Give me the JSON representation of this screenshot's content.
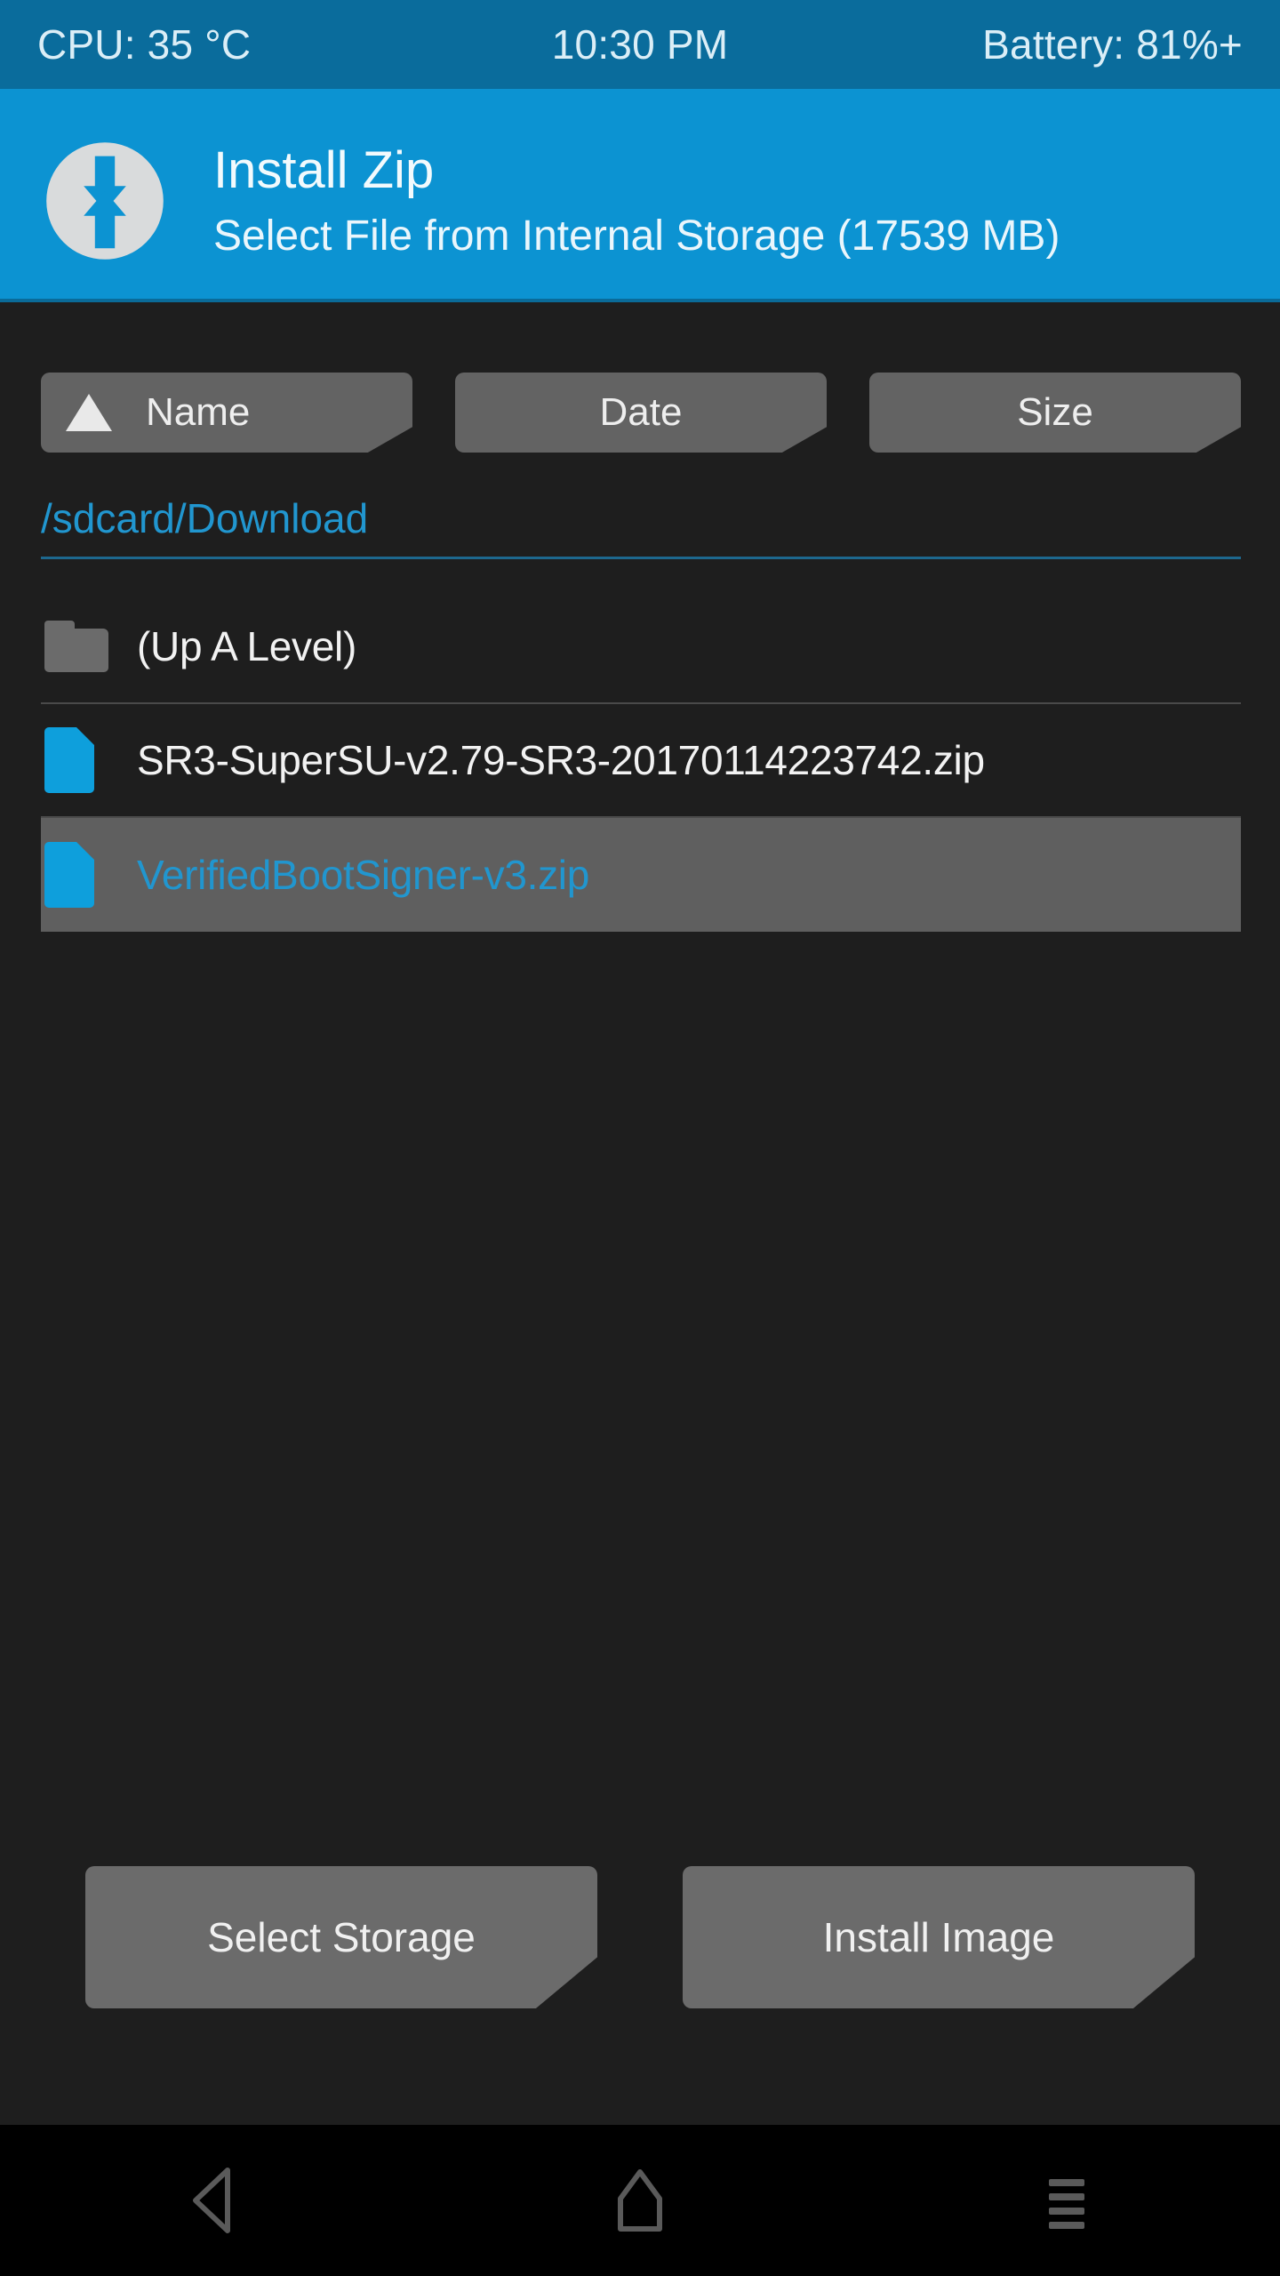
{
  "statusbar": {
    "cpu": "CPU: 35 °C",
    "time": "10:30 PM",
    "battery": "Battery: 81%+"
  },
  "header": {
    "logo_icon": "twrp-logo-icon",
    "title": "Install Zip",
    "subtitle": "Select File from Internal Storage (17539 MB)"
  },
  "sort": {
    "buttons": [
      {
        "label": "Name",
        "icon": "sort-ascending-triangle-icon",
        "active": true
      },
      {
        "label": "Date",
        "icon": "",
        "active": false
      },
      {
        "label": "Size",
        "icon": "",
        "active": false
      }
    ]
  },
  "path": {
    "current": "/sdcard/Download"
  },
  "files": [
    {
      "name": "(Up A Level)",
      "icon": "folder-icon",
      "type": "folder",
      "selected": false
    },
    {
      "name": "SR3-SuperSU-v2.79-SR3-20170114223742.zip",
      "icon": "file-icon",
      "type": "file",
      "selected": false
    },
    {
      "name": "VerifiedBootSigner-v3.zip",
      "icon": "file-icon",
      "type": "file",
      "selected": true
    }
  ],
  "actions": {
    "select_storage": "Select Storage",
    "install_image": "Install Image"
  },
  "navbar": {
    "back_icon": "back-triangle-icon",
    "home_icon": "home-icon",
    "menu_icon": "menu-lines-icon"
  },
  "colors": {
    "statusbar_bg": "#0a6c9c",
    "header_bg": "#0c93d2",
    "content_bg": "#1e1e1e",
    "accent_blue": "#2196cf",
    "button_gray": "#636363",
    "selected_row": "#5f5f5f",
    "navbar_bg": "#000000"
  }
}
